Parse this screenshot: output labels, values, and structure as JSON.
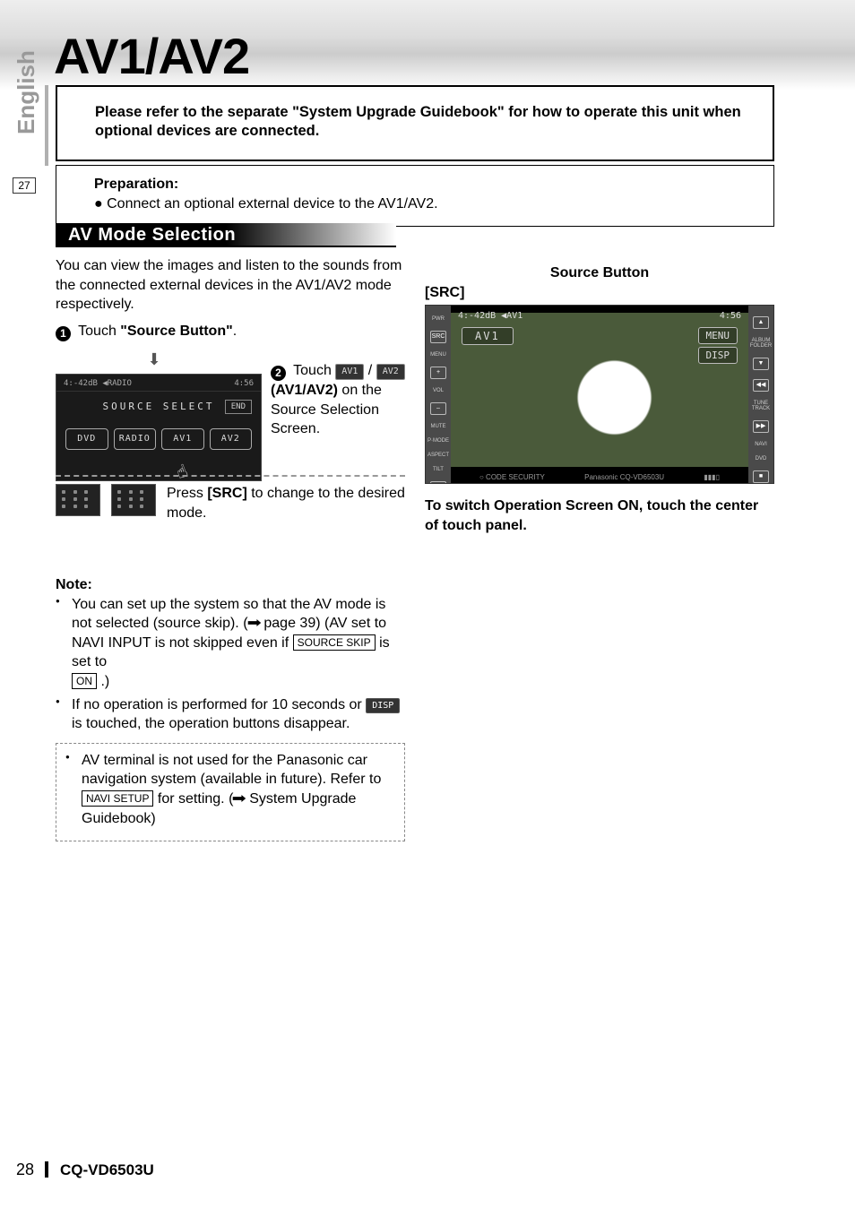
{
  "title": "AV1/AV2",
  "side": {
    "lang": "English",
    "prevPage": "27"
  },
  "infoBox": "Please refer to the separate \"System Upgrade Guidebook\" for how to operate this unit when optional devices are connected.",
  "prep": {
    "heading": "Preparation:",
    "line": "Connect an optional external device to the AV1/AV2."
  },
  "sectionTitle": "AV Mode Selection",
  "intro": "You can view the images and listen to the sounds from the connected external devices in the AV1/AV2 mode respectively.",
  "step1": {
    "pre": "Touch ",
    "bold": "\"Source Button\"",
    "post": "."
  },
  "sourceSelect": {
    "topLeft": "4:-42dB ◀RADIO",
    "clock": "4:56",
    "title": "SOURCE SELECT",
    "end": "END",
    "buttons": [
      "DVD",
      "RADIO",
      "AV1",
      "AV2"
    ]
  },
  "step2": {
    "pre": "Touch ",
    "btnA": "AV1",
    "sep": " / ",
    "btnB": "AV2",
    "line1bold": "(AV1/AV2)",
    "line1rest": " on the Source Selection Screen."
  },
  "remote": {
    "pre": "Press ",
    "key": "[SRC]",
    "rest": " to change to the desired mode."
  },
  "note": {
    "heading": "Note:",
    "li1a": "You can set up the system so that the AV mode is not selected (source skip). (",
    "li1arrow": "➡",
    "li1b": " page 39) (AV set to NAVI INPUT is not skipped even if ",
    "li1box": "SOURCE SKIP",
    "li1c": " is set to ",
    "li1on": "ON",
    "li1d": " .)",
    "li2a": "If no operation is performed for 10 seconds or ",
    "li2chip": "DISP",
    "li2b": " is touched, the operation buttons disappear.",
    "callout_a": "AV terminal is not used for the Panasonic car navigation system (available in future). Refer to ",
    "callout_box": "NAVI SETUP",
    "callout_b": " for setting. (",
    "callout_arrow": "➡",
    "callout_c": " System Upgrade Guidebook)"
  },
  "right": {
    "label": "Source Button",
    "key": "[SRC]",
    "unit": {
      "topLeft": "4:-42dB ◀AV1",
      "clock": "4:56",
      "av1": "AV1",
      "menu": "MENU",
      "disp": "DISP",
      "left": {
        "pwr": "PWR",
        "src": "SRC",
        "menu": "MENU",
        "plus": "+",
        "vol": "VOL",
        "minus": "–",
        "mute": "MUTE",
        "pmode": "P·MODE",
        "aspect": "ASPECT",
        "tilt": "TILT",
        "eject": "▲"
      },
      "right": {
        "album": "ALBUM FOLDER",
        "up": "▲",
        "dn": "▼",
        "prev": "◀◀",
        "tune": "TUNE TRACK",
        "next": "▶▶",
        "navi": "NAVI",
        "dvd": "DVD",
        "ent": "■"
      },
      "foot": {
        "sec": "○ CODE SECURITY",
        "brand": "Panasonic  CQ-VD6503U",
        "spk": "▮▮▮▯"
      }
    },
    "caption": "To switch Operation Screen ON, touch the center of touch panel."
  },
  "footer": {
    "page": "28",
    "model": "CQ-VD6503U"
  }
}
